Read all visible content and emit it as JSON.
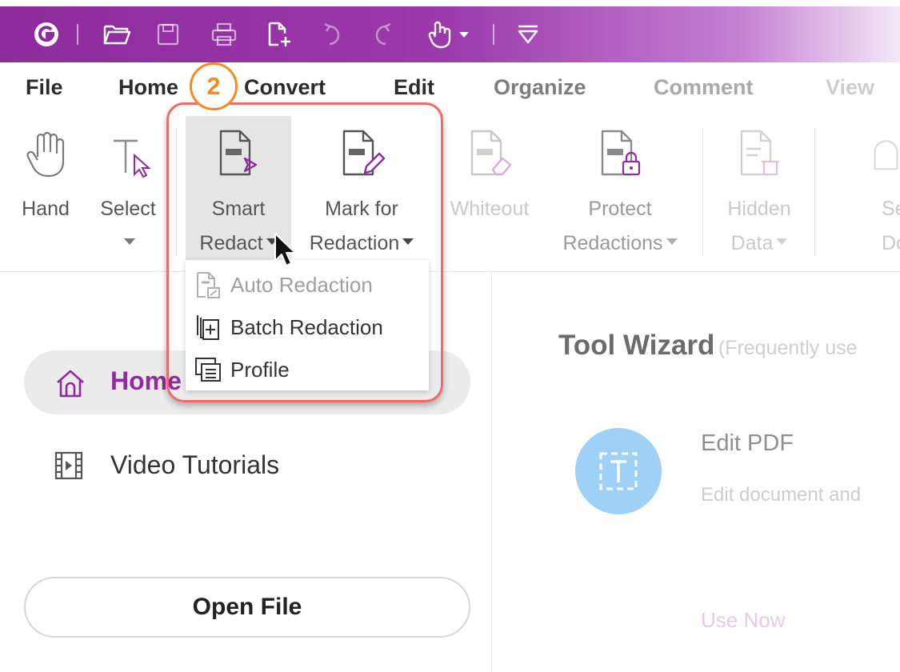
{
  "titlebar": {
    "icons": [
      "app-logo-icon",
      "open-folder-icon",
      "save-icon",
      "print-icon",
      "new-file-icon",
      "undo-icon",
      "redo-icon",
      "hand-touch-icon",
      "customize-toolbar-icon"
    ],
    "colors": {
      "accent": "#8d2a9c"
    }
  },
  "menu": {
    "tabs": [
      "File",
      "Home",
      "Convert",
      "Edit",
      "Organize",
      "Comment",
      "View"
    ]
  },
  "step_badge": "2",
  "ribbon": {
    "hand": "Hand",
    "select": "Select",
    "smart_redact": {
      "line1": "Smart",
      "line2": "Redact"
    },
    "mark_for_redaction": {
      "line1": "Mark for",
      "line2": "Redaction"
    },
    "whiteout": "Whiteout",
    "protect_redactions": {
      "line1": "Protect",
      "line2": "Redactions"
    },
    "hidden_data": {
      "line1": "Hidden",
      "line2": "Data"
    },
    "secure_document": {
      "line1": "Sec",
      "line2": "Docum"
    }
  },
  "dropdown": {
    "items": [
      {
        "label": "Auto Redaction",
        "enabled": false,
        "icon": "auto-redaction-icon"
      },
      {
        "label": "Batch Redaction",
        "enabled": true,
        "icon": "batch-redaction-icon"
      },
      {
        "label": "Profile",
        "enabled": true,
        "icon": "profile-icon"
      }
    ]
  },
  "sidebar": {
    "home": "Home",
    "video_tutorials": "Video Tutorials",
    "open_file": "Open File"
  },
  "tool_wizard": {
    "title": "Tool Wizard",
    "subtitle": "(Frequently use",
    "tool_name": "Edit PDF",
    "tool_desc": "Edit document and",
    "action": "Use Now"
  }
}
